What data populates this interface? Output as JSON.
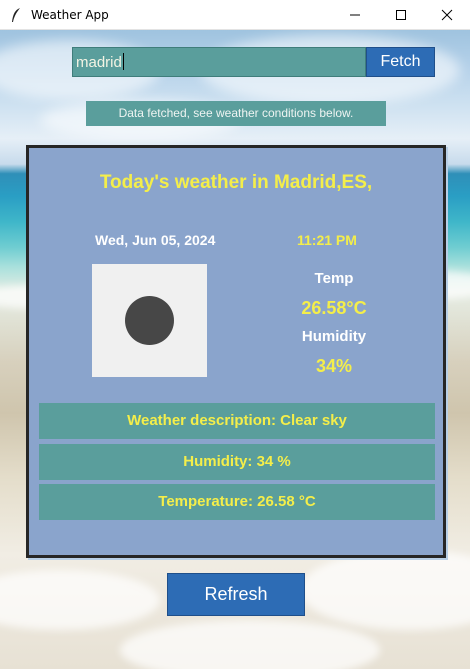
{
  "window": {
    "title": "Weather App",
    "app_icon": "feather-icon",
    "controls": [
      "minimize-icon",
      "maximize-icon",
      "close-icon"
    ]
  },
  "search": {
    "value": "madrid",
    "fetch_label": "Fetch"
  },
  "status": {
    "message": "Data fetched, see weather conditions below."
  },
  "weather": {
    "heading": "Today's weather in Madrid,ES,",
    "date": "Wed, Jun 05, 2024",
    "time": "11:21 PM",
    "condition_icon": "clear-sky-icon",
    "temp_label": "Temp",
    "temp_value": "26.58°C",
    "humidity_label": "Humidity",
    "humidity_value": "34%",
    "description": "Weather description: Clear sky",
    "humidity_line": "Humidity: 34 %",
    "temperature_line": "Temperature: 26.58 °C"
  },
  "actions": {
    "refresh_label": "Refresh"
  },
  "colors": {
    "panel": "#8aa4cc",
    "teal": "#5a9e9c",
    "button": "#2d6cb5",
    "accent_yellow": "#f4ee4a"
  }
}
